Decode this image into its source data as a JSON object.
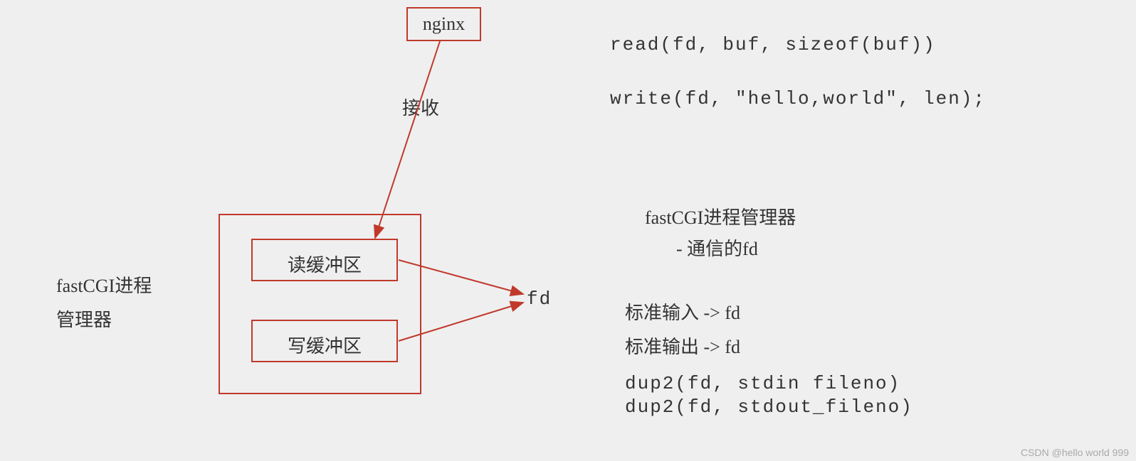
{
  "diagram": {
    "nginx": "nginx",
    "receive": "接收",
    "leftLabelLine1": "fastCGI进程",
    "leftLabelLine2": "管理器",
    "readBuffer": "读缓冲区",
    "writeBuffer": "写缓冲区",
    "fd": "fd"
  },
  "code": {
    "readCall": "read(fd, buf, sizeof(buf))",
    "writeCall": "write(fd, \"hello,world\", len);",
    "pmTitle": "fastCGI进程管理器",
    "pmBullet": "- 通信的fd",
    "stdinLine": "标准输入 -> fd",
    "stdoutLine": "标准输出 -> fd",
    "dup2Stdin": "dup2(fd, stdin fileno)",
    "dup2Stdout": "dup2(fd, stdout_fileno)"
  },
  "watermark": "CSDN @hello world 999"
}
